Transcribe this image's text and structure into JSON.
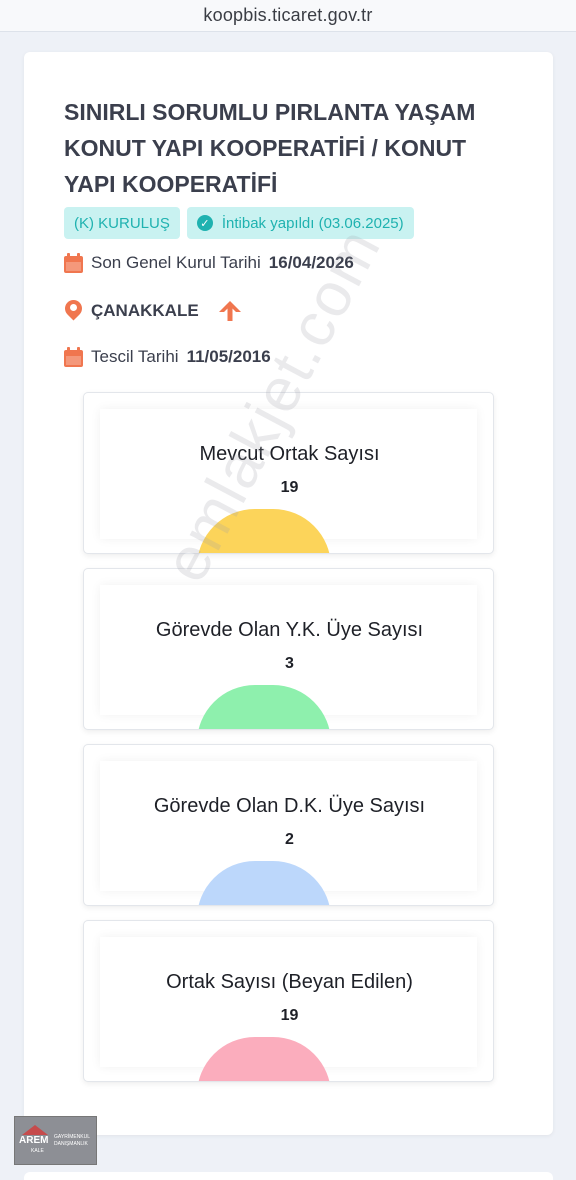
{
  "browser": {
    "url": "koopbis.ticaret.gov.tr"
  },
  "cooperative": {
    "title": "SINIRLI SORUMLU PIRLANTA YAŞAM KONUT YAPI KOOPERATİFİ / KONUT YAPI KOOPERATİFİ",
    "badges": {
      "status": "(K) KURULUŞ",
      "adaptation": "İntibak yapıldı (03.06.2025)"
    },
    "general_assembly": {
      "label": "Son Genel Kurul Tarihi",
      "value": "16/04/2026"
    },
    "city": "ÇANAKKALE",
    "registration": {
      "label": "Tescil Tarihi",
      "value": "11/05/2016"
    }
  },
  "stats": [
    {
      "label": "Mevcut Ortak Sayısı",
      "value": "19",
      "color": "#fcd45a"
    },
    {
      "label": "Görevde Olan Y.K. Üye Sayısı",
      "value": "3",
      "color": "#8ef0ad"
    },
    {
      "label": "Görevde Olan D.K. Üye Sayısı",
      "value": "2",
      "color": "#bcd7fb"
    },
    {
      "label": "Ortak Sayısı (Beyan Edilen)",
      "value": "19",
      "color": "#fbadbd"
    }
  ],
  "watermark": "emlakjet.com",
  "logo": {
    "name": "AREM",
    "sub": "KALE",
    "tagline_1": "GAYRİMENKUL",
    "tagline_2": "DANIŞMANLIK"
  },
  "colors": {
    "accent": "#f0764f",
    "badge_bg": "#c9f2f1",
    "badge_text": "#1fb2b0"
  }
}
